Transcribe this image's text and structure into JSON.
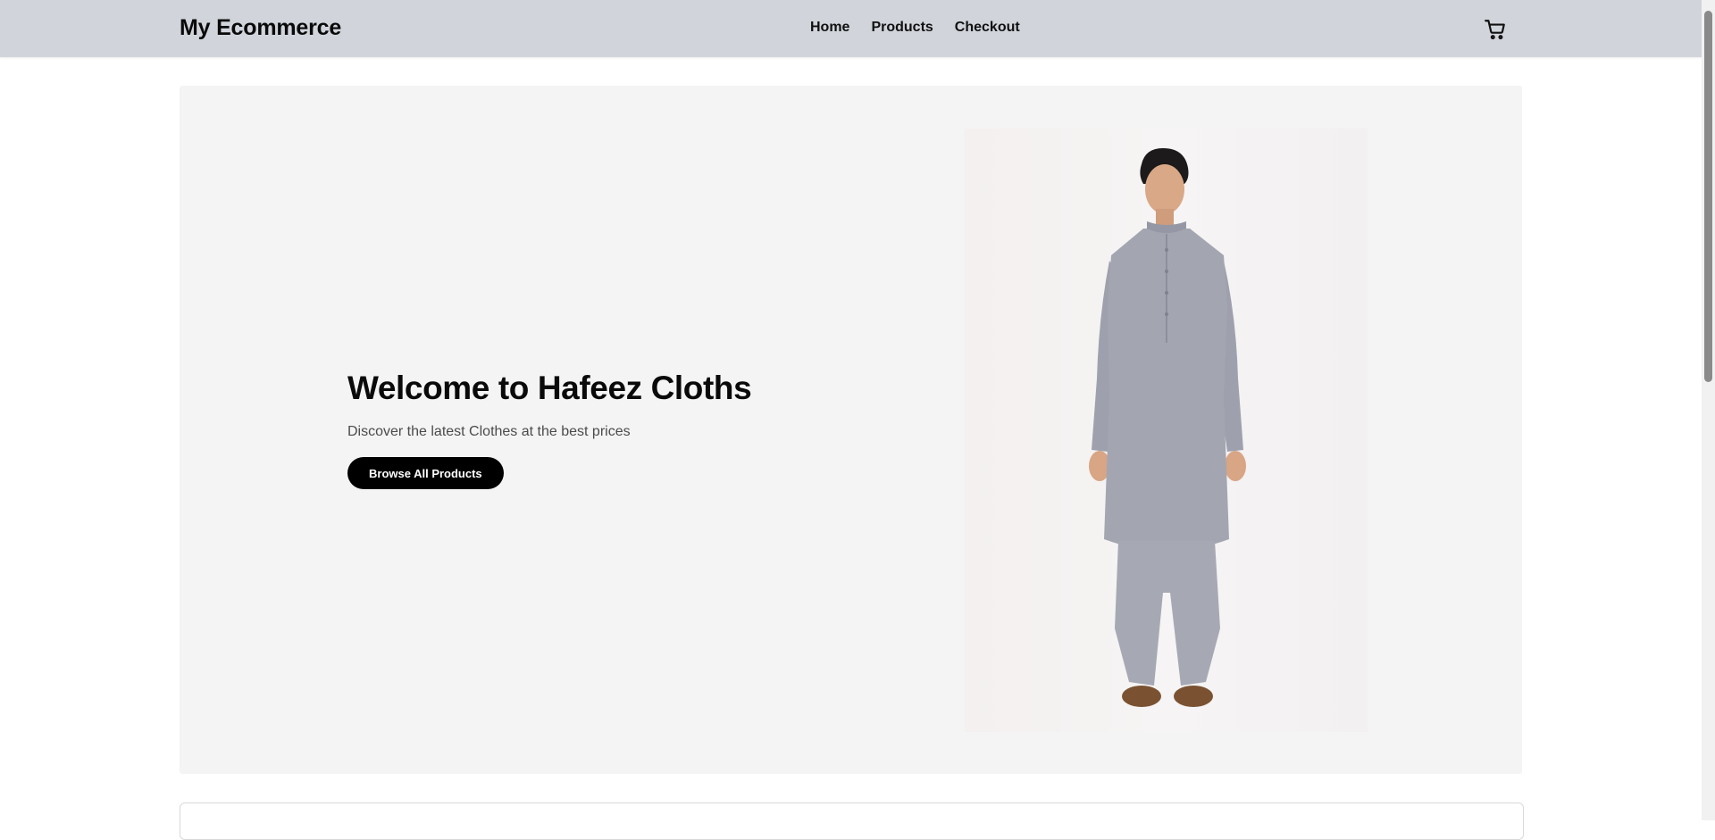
{
  "header": {
    "brand": "My Ecommerce",
    "nav": [
      "Home",
      "Products",
      "Checkout"
    ],
    "cart_icon": "shopping-cart-icon"
  },
  "hero": {
    "title": "Welcome to Hafeez Cloths",
    "subtitle": "Discover the latest Clothes at the best prices",
    "cta_label": "Browse All Products"
  },
  "colors": {
    "navbar_bg": "#d1d5db",
    "hero_bg": "#f4f4f4",
    "button_bg": "#000000",
    "garment": "#a3a6b1"
  }
}
